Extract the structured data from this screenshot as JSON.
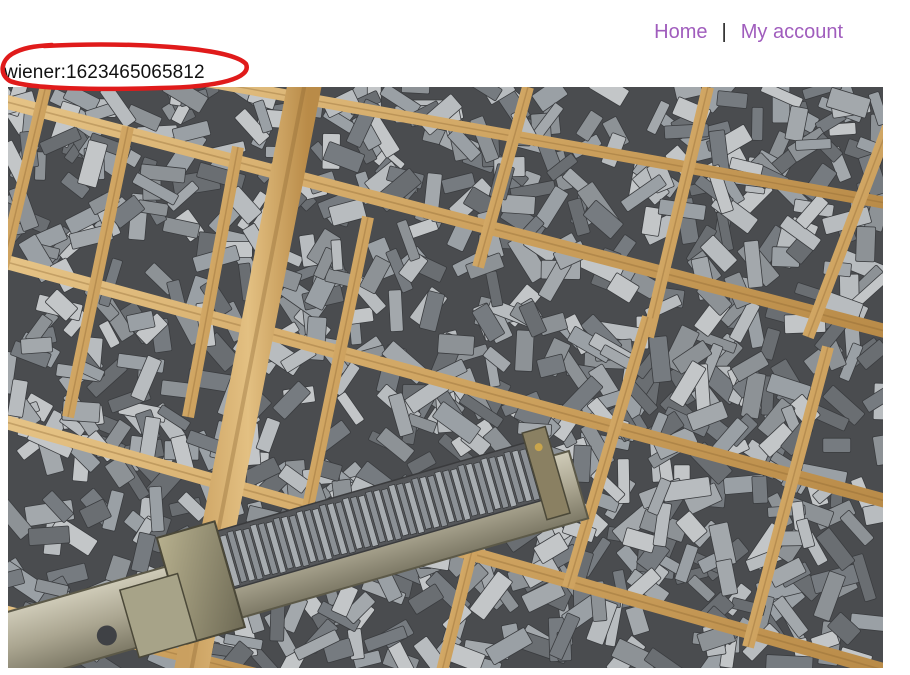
{
  "nav": {
    "home_label": "Home",
    "separator": "|",
    "account_label": "My account",
    "link_color": "#a05dbd"
  },
  "session": {
    "token_text": "wiener:1623465065812"
  },
  "annotation": {
    "type": "red-ellipse",
    "color": "#e01b1b"
  },
  "hero": {
    "subject": "wooden type case filled with metal letterpress type and a composing stick",
    "icon": "photo-image"
  }
}
